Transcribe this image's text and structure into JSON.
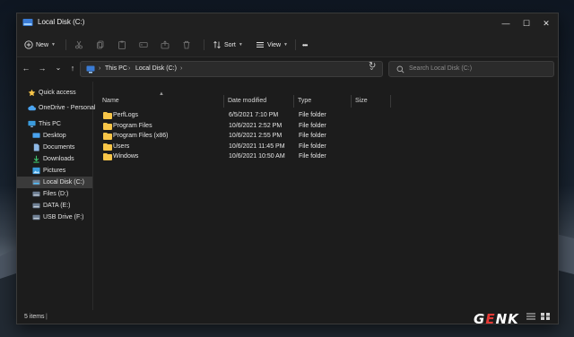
{
  "window": {
    "title": "Local Disk (C:)",
    "controls": {
      "minimize": "—",
      "maximize": "☐",
      "close": "✕"
    }
  },
  "toolbar": {
    "new_label": "New",
    "sort_label": "Sort",
    "view_label": "View",
    "more_label": "•••",
    "icons": [
      "cut-icon",
      "copy-icon",
      "paste-icon",
      "rename-icon",
      "share-icon",
      "delete-icon"
    ]
  },
  "nav": {
    "back": "←",
    "forward": "→",
    "recent": "⌄",
    "up": "↑",
    "breadcrumb": [
      "This PC",
      "Local Disk (C:)"
    ],
    "sep": "›",
    "search_placeholder": "Search Local Disk (C:)",
    "refresh": "↻"
  },
  "sidebar": {
    "items": [
      {
        "label": "Quick access",
        "icon": "star-icon"
      },
      {
        "label": "OneDrive - Personal",
        "icon": "cloud-icon"
      },
      {
        "label": "This PC",
        "icon": "computer-icon"
      },
      {
        "label": "Desktop",
        "icon": "desktop-icon"
      },
      {
        "label": "Documents",
        "icon": "documents-icon"
      },
      {
        "label": "Downloads",
        "icon": "download-icon"
      },
      {
        "label": "Pictures",
        "icon": "pictures-icon"
      },
      {
        "label": "Local Disk (C:)",
        "icon": "drive-icon"
      },
      {
        "label": "Files (D:)",
        "icon": "drive-icon"
      },
      {
        "label": "DATA (E:)",
        "icon": "drive-icon"
      },
      {
        "label": "USB Drive (F:)",
        "icon": "usb-drive-icon"
      }
    ]
  },
  "columns": {
    "name": "Name",
    "date": "Date modified",
    "type": "Type",
    "size": "Size"
  },
  "files": [
    {
      "name": "PerfLogs",
      "date": "6/5/2021 7:10 PM",
      "type": "File folder"
    },
    {
      "name": "Program Files",
      "date": "10/6/2021 2:52 PM",
      "type": "File folder"
    },
    {
      "name": "Program Files (x86)",
      "date": "10/6/2021 2:55 PM",
      "type": "File folder"
    },
    {
      "name": "Users",
      "date": "10/6/2021 11:45 PM",
      "type": "File folder"
    },
    {
      "name": "Windows",
      "date": "10/6/2021 10:50 AM",
      "type": "File folder"
    }
  ],
  "status": {
    "count": "5 items",
    "bar": "|"
  },
  "watermark": {
    "g": "G",
    "e": "E",
    "nk": "NK"
  },
  "colors": {
    "accent": "#4cc2ff",
    "folder": "#f7c548",
    "window_bg": "#1c1c1c",
    "selection": "#3a3a3a",
    "watermark_red": "#e53935"
  }
}
